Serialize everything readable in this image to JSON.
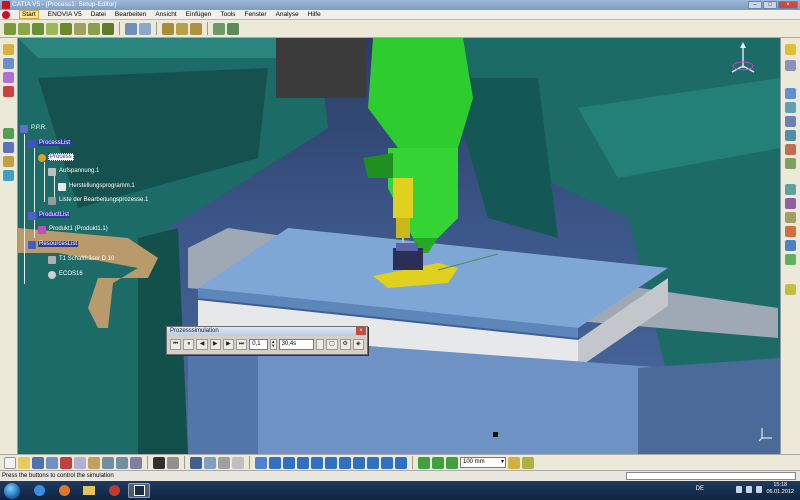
{
  "window": {
    "title": "CATIA V5 - [Process1: Setup-Editor]"
  },
  "menu": {
    "items": [
      "Start",
      "ENOVIA V5",
      "Datei",
      "Bearbeiten",
      "Ansicht",
      "Einfügen",
      "Tools",
      "Fenster",
      "Analyse",
      "Hilfe"
    ]
  },
  "spec_tree": {
    "nodes": [
      {
        "label": "P.P.R."
      },
      {
        "label": "ProcessList"
      },
      {
        "label": "Process"
      },
      {
        "label": "Aufspannung.1"
      },
      {
        "label": "Herstellungsprogramm.1"
      },
      {
        "label": "Liste der Bearbeitungsprozesse.1"
      },
      {
        "label": "ProductList"
      },
      {
        "label": "Produkt1 (Produkt1.1)"
      },
      {
        "label": "ResourcesList"
      },
      {
        "label": "T1 Schaftfräser D 10"
      },
      {
        "label": "ECOS16"
      }
    ]
  },
  "process_simulation": {
    "title": "Prozesssimulation",
    "step_value": "0,1",
    "time_value": "30,4s",
    "buttons": [
      "skip-to-start",
      "step-back",
      "play-backward",
      "pause",
      "play-forward",
      "skip-to-end"
    ],
    "button_glyphs": [
      "⏮",
      "⏸",
      "◀",
      "▶",
      "▶",
      "⏭"
    ]
  },
  "bottom_toolbar": {
    "unit_value": "100 mm"
  },
  "status": {
    "text": "Press the buttons to control the simulation"
  },
  "taskbar": {
    "language": "DE",
    "time": "15:18",
    "date": "06.01.2012"
  },
  "colors": {
    "machine_teal": "#1c6b67",
    "spindle_green": "#2ecc2e",
    "table_blue": "#7fa7d6",
    "fixture_yellow": "#e0d020",
    "wood_tan": "#b99a6a"
  }
}
